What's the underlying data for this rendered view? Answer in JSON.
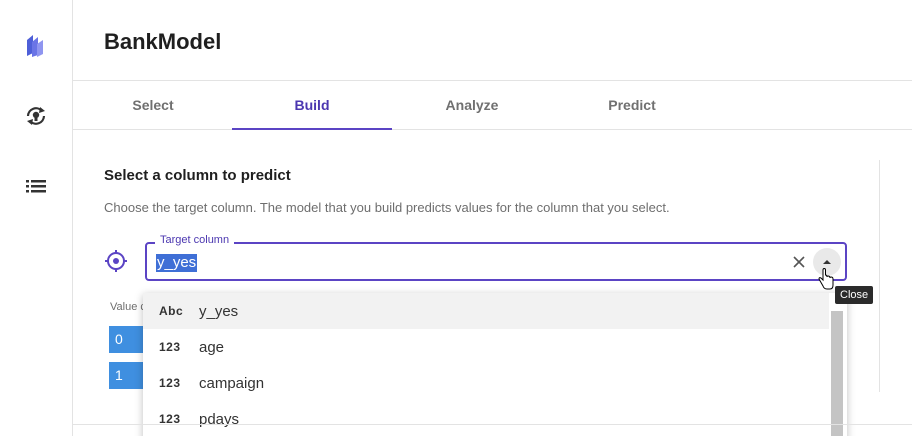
{
  "app": {
    "title": "BankModel"
  },
  "rail": {
    "items": [
      "logo-icon",
      "refresh-bulb-icon",
      "list-icon"
    ]
  },
  "tabs": [
    {
      "label": "Select"
    },
    {
      "label": "Build",
      "active": true
    },
    {
      "label": "Analyze"
    },
    {
      "label": "Predict"
    }
  ],
  "target": {
    "title": "Select a column to predict",
    "description": "Choose the target column. The model that you build predicts values for the column that you select.",
    "field_label": "Target column",
    "value": "y_yes"
  },
  "tooltip": {
    "text": "Close"
  },
  "value_table": {
    "header": "Value c",
    "rows": [
      "0",
      "1"
    ]
  },
  "dropdown": {
    "options": [
      {
        "type": "Abc",
        "label": "y_yes"
      },
      {
        "type": "123",
        "label": "age"
      },
      {
        "type": "123",
        "label": "campaign"
      },
      {
        "type": "123",
        "label": "pdays"
      }
    ]
  },
  "colors": {
    "accent": "#5b44c4",
    "selection": "#3f6fd6",
    "cell": "#3f8fe0"
  }
}
